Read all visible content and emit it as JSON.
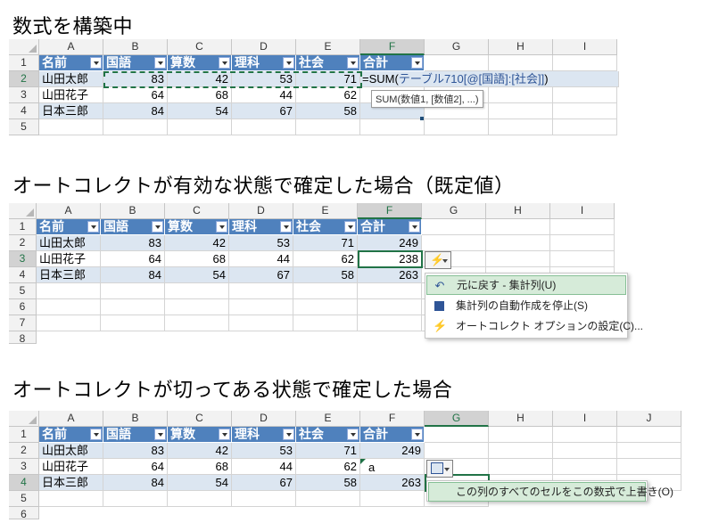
{
  "headings": {
    "h1": "数式を構築中",
    "h2": "オートコレクトが有効な状態で確定した場合（既定値）",
    "h3": "オートコレクトが切ってある状態で確定した場合"
  },
  "columns": [
    "A",
    "B",
    "C",
    "D",
    "E",
    "F",
    "G",
    "H",
    "I"
  ],
  "columns3": [
    "A",
    "B",
    "C",
    "D",
    "E",
    "F",
    "G",
    "H",
    "I",
    "J"
  ],
  "table_headers": [
    "名前",
    "国語",
    "算数",
    "理科",
    "社会",
    "合計"
  ],
  "rows": [
    {
      "num": "2",
      "name": "山田太郎",
      "v": [
        "83",
        "42",
        "53",
        "71"
      ]
    },
    {
      "num": "3",
      "name": "山田花子",
      "v": [
        "64",
        "68",
        "44",
        "62"
      ]
    },
    {
      "num": "4",
      "name": "日本三郎",
      "v": [
        "84",
        "54",
        "67",
        "58"
      ]
    }
  ],
  "row_numbers_1": [
    "1",
    "2",
    "3",
    "4",
    "5"
  ],
  "row_numbers_2": [
    "1",
    "2",
    "3",
    "4",
    "5",
    "6",
    "7",
    "8"
  ],
  "row_numbers_3": [
    "1",
    "2",
    "3",
    "4",
    "5",
    "6"
  ],
  "sheet1": {
    "formula_prefix": "=SUM(",
    "formula_ref": "テーブル710[@[国語]:[社会]]",
    "formula_suffix": ")",
    "tooltip": "SUM(数値1, [数値2], ...)"
  },
  "sheet2": {
    "totals": [
      "249",
      "238",
      "263"
    ],
    "menu": [
      {
        "icon": "undo-icon",
        "label": "元に戻す - 集計列(U)"
      },
      {
        "icon": "stop-icon",
        "label": "集計列の自動作成を停止(S)"
      },
      {
        "icon": "autocorrect-options-icon",
        "label": "オートコレクト オプションの設定(C)..."
      }
    ]
  },
  "sheet3": {
    "total_r2": "249",
    "total_r4": "263",
    "stray_char": "a",
    "menu": [
      {
        "label": "この列のすべてのセルをこの数式で上書き(O)"
      }
    ]
  },
  "colors": {
    "table_header": "#4f81bd",
    "band": "#dce6f1",
    "excel_green": "#217346"
  }
}
